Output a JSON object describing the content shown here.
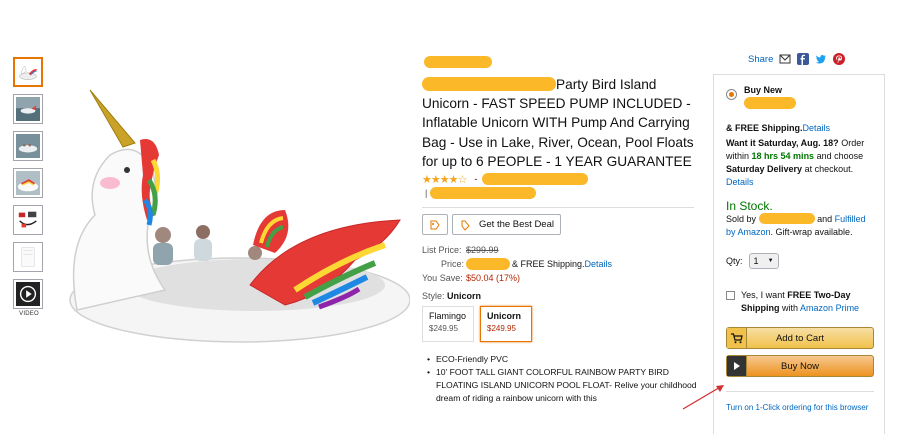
{
  "thumbnails": [
    {
      "name": "thumb-unicorn-float",
      "active": true
    },
    {
      "name": "thumb-lake-scene",
      "active": false
    },
    {
      "name": "thumb-party-scene",
      "active": false
    },
    {
      "name": "thumb-people-float",
      "active": false
    },
    {
      "name": "thumb-pump-accessories",
      "active": false
    },
    {
      "name": "thumb-dimensions",
      "active": false
    },
    {
      "name": "thumb-video",
      "active": false
    }
  ],
  "video_label": "VIDEO",
  "product": {
    "title_visible_start": "Party Bird Island",
    "title_rest": "Unicorn - FAST SPEED PUMP INCLUDED - Inflatable Unicorn WITH Pump And Carrying Bag - Use in Lake, River, Ocean, Pool Floats for up to 6 PEOPLE - 1 YEAR GUARANTEE",
    "rating_stars": 4.5,
    "rating_dash": "-",
    "deal_icon_label": "Get the Best Deal",
    "list_price_label": "List Price:",
    "list_price": "$299.99",
    "price_label": "Price:",
    "price_suffix": "& FREE Shipping.",
    "details_link": "Details",
    "you_save_label": "You Save:",
    "you_save": "$50.04 (17%)",
    "style_label": "Style:",
    "style_value": "Unicorn",
    "swatches": [
      {
        "name": "Flamingo",
        "price": "$249.95",
        "selected": false
      },
      {
        "name": "Unicorn",
        "price": "$249.95",
        "selected": true
      }
    ],
    "bullets": [
      "ECO-Friendly PVC",
      "10' FOOT TALL GIANT COLORFUL RAINBOW PARTY BIRD FLOATING ISLAND UNICORN POOL FLOAT- Relive your childhood dream of riding a rainbow unicorn with this"
    ]
  },
  "share": {
    "label": "Share"
  },
  "buybox": {
    "buy_new": "Buy New",
    "free_shipping": "& FREE Shipping.",
    "details": "Details",
    "want_it": "Want it Saturday, Aug. 18?",
    "order_within": "Order within",
    "countdown": "18 hrs 54 mins",
    "choose": "and choose",
    "saturday_delivery": "Saturday Delivery",
    "at_checkout": "at checkout.",
    "details2": "Details",
    "in_stock": "In Stock.",
    "sold_by": "Sold by",
    "and": "and",
    "fulfilled": "Fulfilled by Amazon",
    "gift_wrap": ". Gift-wrap available.",
    "qty_label": "Qty:",
    "qty_value": "1",
    "prime_text_pre": "Yes, I want",
    "prime_text_bold": "FREE Two-Day Shipping",
    "prime_text_with": "with",
    "prime_link": "Amazon Prime",
    "add_to_cart": "Add to Cart",
    "buy_now": "Buy Now",
    "one_click": "Turn on 1-Click ordering for this browser"
  },
  "colors": {
    "accent": "#e77600",
    "link": "#0066c0",
    "green": "#007600",
    "price_red": "#b12704",
    "redaction": "#fbb829"
  }
}
